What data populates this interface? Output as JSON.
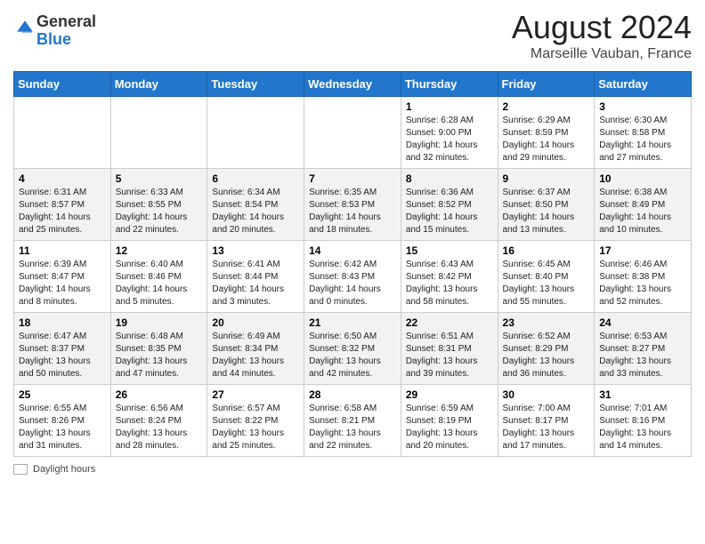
{
  "header": {
    "logo_general": "General",
    "logo_blue": "Blue",
    "main_title": "August 2024",
    "subtitle": "Marseille Vauban, France"
  },
  "calendar": {
    "days_of_week": [
      "Sunday",
      "Monday",
      "Tuesday",
      "Wednesday",
      "Thursday",
      "Friday",
      "Saturday"
    ],
    "weeks": [
      [
        {
          "day": "",
          "info": ""
        },
        {
          "day": "",
          "info": ""
        },
        {
          "day": "",
          "info": ""
        },
        {
          "day": "",
          "info": ""
        },
        {
          "day": "1",
          "info": "Sunrise: 6:28 AM\nSunset: 9:00 PM\nDaylight: 14 hours\nand 32 minutes."
        },
        {
          "day": "2",
          "info": "Sunrise: 6:29 AM\nSunset: 8:59 PM\nDaylight: 14 hours\nand 29 minutes."
        },
        {
          "day": "3",
          "info": "Sunrise: 6:30 AM\nSunset: 8:58 PM\nDaylight: 14 hours\nand 27 minutes."
        }
      ],
      [
        {
          "day": "4",
          "info": "Sunrise: 6:31 AM\nSunset: 8:57 PM\nDaylight: 14 hours\nand 25 minutes."
        },
        {
          "day": "5",
          "info": "Sunrise: 6:33 AM\nSunset: 8:55 PM\nDaylight: 14 hours\nand 22 minutes."
        },
        {
          "day": "6",
          "info": "Sunrise: 6:34 AM\nSunset: 8:54 PM\nDaylight: 14 hours\nand 20 minutes."
        },
        {
          "day": "7",
          "info": "Sunrise: 6:35 AM\nSunset: 8:53 PM\nDaylight: 14 hours\nand 18 minutes."
        },
        {
          "day": "8",
          "info": "Sunrise: 6:36 AM\nSunset: 8:52 PM\nDaylight: 14 hours\nand 15 minutes."
        },
        {
          "day": "9",
          "info": "Sunrise: 6:37 AM\nSunset: 8:50 PM\nDaylight: 14 hours\nand 13 minutes."
        },
        {
          "day": "10",
          "info": "Sunrise: 6:38 AM\nSunset: 8:49 PM\nDaylight: 14 hours\nand 10 minutes."
        }
      ],
      [
        {
          "day": "11",
          "info": "Sunrise: 6:39 AM\nSunset: 8:47 PM\nDaylight: 14 hours\nand 8 minutes."
        },
        {
          "day": "12",
          "info": "Sunrise: 6:40 AM\nSunset: 8:46 PM\nDaylight: 14 hours\nand 5 minutes."
        },
        {
          "day": "13",
          "info": "Sunrise: 6:41 AM\nSunset: 8:44 PM\nDaylight: 14 hours\nand 3 minutes."
        },
        {
          "day": "14",
          "info": "Sunrise: 6:42 AM\nSunset: 8:43 PM\nDaylight: 14 hours\nand 0 minutes."
        },
        {
          "day": "15",
          "info": "Sunrise: 6:43 AM\nSunset: 8:42 PM\nDaylight: 13 hours\nand 58 minutes."
        },
        {
          "day": "16",
          "info": "Sunrise: 6:45 AM\nSunset: 8:40 PM\nDaylight: 13 hours\nand 55 minutes."
        },
        {
          "day": "17",
          "info": "Sunrise: 6:46 AM\nSunset: 8:38 PM\nDaylight: 13 hours\nand 52 minutes."
        }
      ],
      [
        {
          "day": "18",
          "info": "Sunrise: 6:47 AM\nSunset: 8:37 PM\nDaylight: 13 hours\nand 50 minutes."
        },
        {
          "day": "19",
          "info": "Sunrise: 6:48 AM\nSunset: 8:35 PM\nDaylight: 13 hours\nand 47 minutes."
        },
        {
          "day": "20",
          "info": "Sunrise: 6:49 AM\nSunset: 8:34 PM\nDaylight: 13 hours\nand 44 minutes."
        },
        {
          "day": "21",
          "info": "Sunrise: 6:50 AM\nSunset: 8:32 PM\nDaylight: 13 hours\nand 42 minutes."
        },
        {
          "day": "22",
          "info": "Sunrise: 6:51 AM\nSunset: 8:31 PM\nDaylight: 13 hours\nand 39 minutes."
        },
        {
          "day": "23",
          "info": "Sunrise: 6:52 AM\nSunset: 8:29 PM\nDaylight: 13 hours\nand 36 minutes."
        },
        {
          "day": "24",
          "info": "Sunrise: 6:53 AM\nSunset: 8:27 PM\nDaylight: 13 hours\nand 33 minutes."
        }
      ],
      [
        {
          "day": "25",
          "info": "Sunrise: 6:55 AM\nSunset: 8:26 PM\nDaylight: 13 hours\nand 31 minutes."
        },
        {
          "day": "26",
          "info": "Sunrise: 6:56 AM\nSunset: 8:24 PM\nDaylight: 13 hours\nand 28 minutes."
        },
        {
          "day": "27",
          "info": "Sunrise: 6:57 AM\nSunset: 8:22 PM\nDaylight: 13 hours\nand 25 minutes."
        },
        {
          "day": "28",
          "info": "Sunrise: 6:58 AM\nSunset: 8:21 PM\nDaylight: 13 hours\nand 22 minutes."
        },
        {
          "day": "29",
          "info": "Sunrise: 6:59 AM\nSunset: 8:19 PM\nDaylight: 13 hours\nand 20 minutes."
        },
        {
          "day": "30",
          "info": "Sunrise: 7:00 AM\nSunset: 8:17 PM\nDaylight: 13 hours\nand 17 minutes."
        },
        {
          "day": "31",
          "info": "Sunrise: 7:01 AM\nSunset: 8:16 PM\nDaylight: 13 hours\nand 14 minutes."
        }
      ]
    ]
  },
  "legend": {
    "label": "Daylight hours"
  }
}
